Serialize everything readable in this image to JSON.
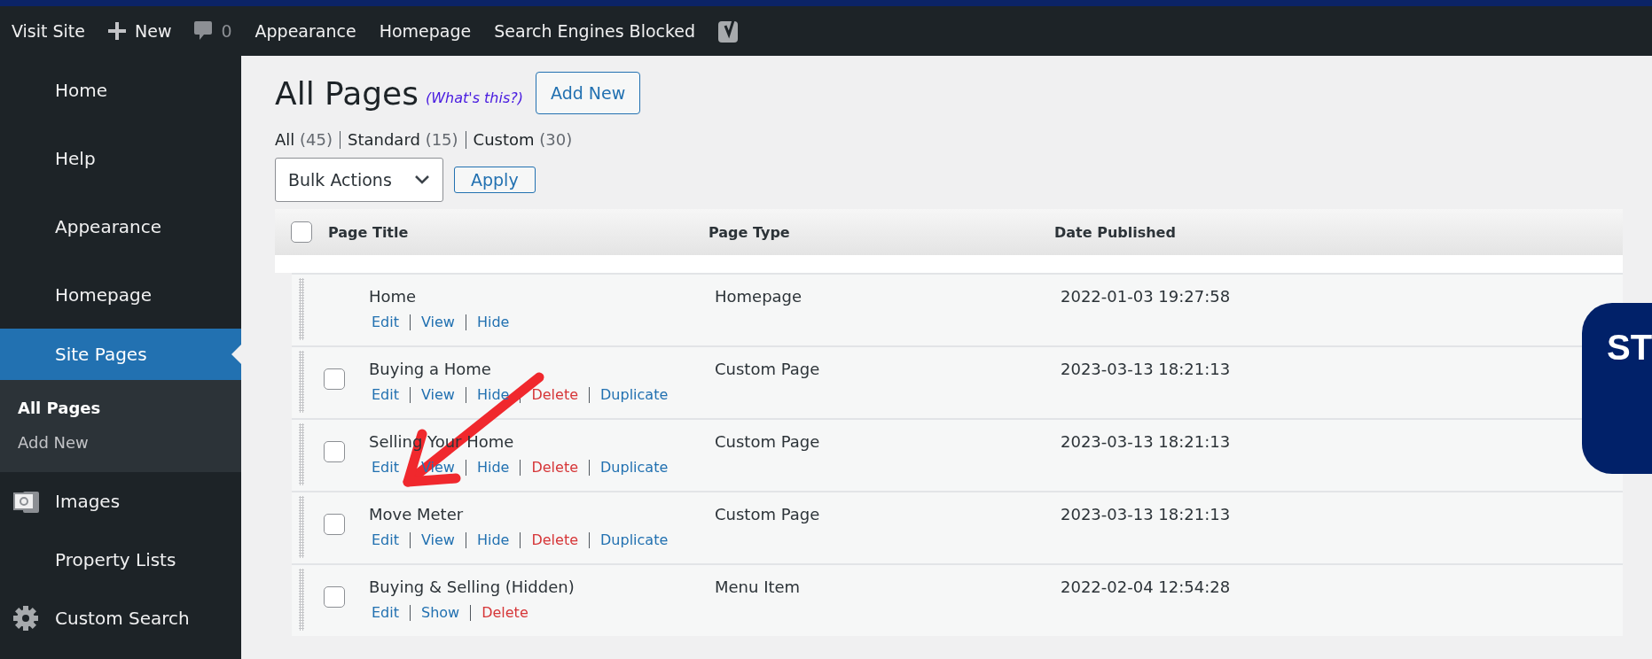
{
  "admin_bar": {
    "items": [
      {
        "kind": "link",
        "label": "Visit Site"
      },
      {
        "kind": "new",
        "label": "New"
      },
      {
        "kind": "comments",
        "label": "0"
      },
      {
        "kind": "link",
        "label": "Appearance"
      },
      {
        "kind": "link",
        "label": "Homepage"
      },
      {
        "kind": "link",
        "label": "Search Engines Blocked"
      },
      {
        "kind": "logo"
      }
    ]
  },
  "sidebar": {
    "items": [
      {
        "label": "Home",
        "kind": "plain",
        "selected": false
      },
      {
        "label": "Help",
        "kind": "plain",
        "selected": false
      },
      {
        "label": "Appearance",
        "kind": "plain",
        "selected": false
      },
      {
        "label": "Homepage",
        "kind": "plain",
        "selected": false
      },
      {
        "label": "Site Pages",
        "kind": "plain",
        "selected": true,
        "children": [
          {
            "label": "All Pages",
            "selected": true
          },
          {
            "label": "Add New",
            "selected": false
          }
        ]
      },
      {
        "label": "Images",
        "kind": "images",
        "selected": false
      },
      {
        "label": "Property Lists",
        "kind": "plain",
        "selected": false
      },
      {
        "label": "Custom Search",
        "kind": "gear",
        "selected": false
      }
    ]
  },
  "content": {
    "title": "All Pages",
    "help_link": "(What's this?)",
    "add_button": "Add New",
    "filters": [
      {
        "label": "All",
        "count": "(45)"
      },
      {
        "label": "Standard",
        "count": "(15)"
      },
      {
        "label": "Custom",
        "count": "(30)"
      }
    ],
    "bulk_select": {
      "value": "Bulk Actions"
    },
    "apply_button": "Apply",
    "table": {
      "columns": [
        "Page Title",
        "Page Type",
        "Date Published"
      ],
      "header_checked": false,
      "rows": [
        {
          "kind": "fixed",
          "title": "Home",
          "page_type": "Homepage",
          "date": "2022-01-03 19:27:58",
          "actions": [
            {
              "label": "Edit",
              "kind": "normal"
            },
            {
              "label": "View",
              "kind": "normal"
            },
            {
              "label": "Hide",
              "kind": "normal"
            }
          ]
        },
        {
          "kind": "page",
          "checked": false,
          "title": "Buying a Home",
          "page_type": "Custom Page",
          "date": "2023-03-13 18:21:13",
          "actions": [
            {
              "label": "Edit",
              "kind": "normal"
            },
            {
              "label": "View",
              "kind": "normal"
            },
            {
              "label": "Hide",
              "kind": "normal"
            },
            {
              "label": "Delete",
              "kind": "danger"
            },
            {
              "label": "Duplicate",
              "kind": "normal"
            }
          ]
        },
        {
          "kind": "page",
          "checked": false,
          "title": "Selling Your Home",
          "page_type": "Custom Page",
          "date": "2023-03-13 18:21:13",
          "actions": [
            {
              "label": "Edit",
              "kind": "normal"
            },
            {
              "label": "View",
              "kind": "normal"
            },
            {
              "label": "Hide",
              "kind": "normal"
            },
            {
              "label": "Delete",
              "kind": "danger"
            },
            {
              "label": "Duplicate",
              "kind": "normal"
            }
          ]
        },
        {
          "kind": "page",
          "checked": false,
          "title": "Move Meter",
          "page_type": "Custom Page",
          "date": "2023-03-13 18:21:13",
          "actions": [
            {
              "label": "Edit",
              "kind": "normal"
            },
            {
              "label": "View",
              "kind": "normal"
            },
            {
              "label": "Hide",
              "kind": "normal"
            },
            {
              "label": "Delete",
              "kind": "danger"
            },
            {
              "label": "Duplicate",
              "kind": "normal"
            }
          ]
        },
        {
          "kind": "page",
          "checked": false,
          "title": "Buying & Selling (Hidden)",
          "page_type": "Menu Item",
          "date": "2022-02-04 12:54:28",
          "actions": [
            {
              "label": "Edit",
              "kind": "normal"
            },
            {
              "label": "Show",
              "kind": "normal"
            },
            {
              "label": "Delete",
              "kind": "danger"
            }
          ]
        }
      ]
    }
  },
  "callout": {
    "text": "ST"
  }
}
